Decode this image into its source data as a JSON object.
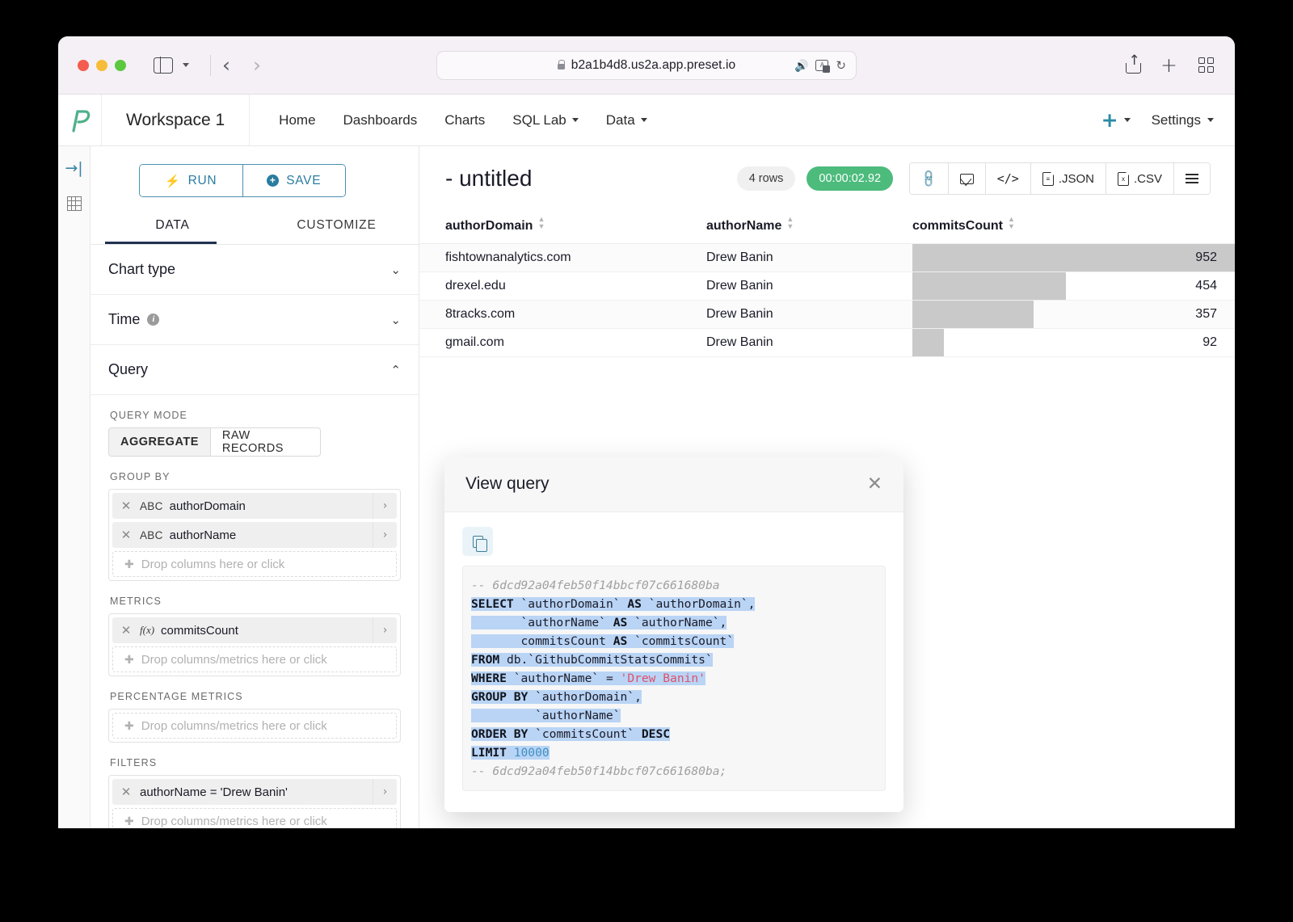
{
  "browser": {
    "url": "b2a1b4d8.us2a.app.preset.io",
    "lock_icon": "lock-icon",
    "back_glyph": "‹",
    "forward_glyph": "›",
    "speaker_glyph": "🔊",
    "reload_glyph": "↻",
    "translate_label": "A"
  },
  "appnav": {
    "logo": "preset-logo",
    "workspace": "Workspace 1",
    "links": [
      {
        "label": "Home",
        "caret": false
      },
      {
        "label": "Dashboards",
        "caret": false
      },
      {
        "label": "Charts",
        "caret": false
      },
      {
        "label": "SQL Lab",
        "caret": true
      },
      {
        "label": "Data",
        "caret": true
      }
    ],
    "plus_label": "+",
    "settings_label": "Settings"
  },
  "rail": {
    "expand_glyph": "→|",
    "table_icon": "table-icon"
  },
  "control_panel": {
    "run_label": "RUN",
    "run_icon": "⚡",
    "save_label": "SAVE",
    "tabs": [
      {
        "label": "DATA",
        "active": true
      },
      {
        "label": "CUSTOMIZE",
        "active": false
      }
    ],
    "sections": [
      {
        "label": "Chart type",
        "expanded": false,
        "chev": "⌄"
      },
      {
        "label": "Time",
        "expanded": false,
        "chev": "⌄",
        "info": true
      },
      {
        "label": "Query",
        "expanded": true,
        "chev": "⌃"
      }
    ],
    "query": {
      "query_mode_label": "QUERY MODE",
      "modes": [
        {
          "label": "AGGREGATE",
          "selected": true
        },
        {
          "label": "RAW RECORDS",
          "selected": false
        }
      ],
      "group_by_label": "GROUP BY",
      "group_by": [
        {
          "type": "ABC",
          "label": "authorDomain"
        },
        {
          "type": "ABC",
          "label": "authorName"
        }
      ],
      "group_by_placeholder": "Drop columns here or click",
      "metrics_label": "METRICS",
      "metrics": [
        {
          "type": "f(x)",
          "label": "commitsCount"
        }
      ],
      "metrics_placeholder": "Drop columns/metrics here or click",
      "percentage_metrics_label": "PERCENTAGE METRICS",
      "percentage_metrics_placeholder": "Drop columns/metrics here or click",
      "filters_label": "FILTERS",
      "filters": [
        {
          "label": "authorName = 'Drew Banin'"
        }
      ],
      "filters_placeholder": "Drop columns/metrics here or click"
    }
  },
  "results": {
    "title": "- untitled",
    "rows_badge": "4 rows",
    "time_badge": "00:00:02.92",
    "time_badge_color": "#4cbb7c",
    "toolbar": [
      {
        "name": "share-link-button",
        "label": ""
      },
      {
        "name": "email-button",
        "label": ""
      },
      {
        "name": "embed-code-button",
        "label": ""
      },
      {
        "name": "download-json-button",
        "label": ".JSON"
      },
      {
        "name": "download-csv-button",
        "label": ".CSV"
      },
      {
        "name": "more-menu-button",
        "label": ""
      }
    ],
    "columns": [
      "authorDomain",
      "authorName",
      "commitsCount"
    ],
    "rows": [
      {
        "authorDomain": "fishtownanalytics.com",
        "authorName": "Drew Banin",
        "commitsCount": "952",
        "bar_pct": 100
      },
      {
        "authorDomain": "drexel.edu",
        "authorName": "Drew Banin",
        "commitsCount": "454",
        "bar_pct": 47.7
      },
      {
        "authorDomain": "8tracks.com",
        "authorName": "Drew Banin",
        "commitsCount": "357",
        "bar_pct": 37.5
      },
      {
        "authorDomain": "gmail.com",
        "authorName": "Drew Banin",
        "commitsCount": "92",
        "bar_pct": 9.7
      }
    ]
  },
  "modal": {
    "title": "View query",
    "close_glyph": "✕",
    "copy_icon": "copy-icon",
    "sql_hash_top": "-- 6dcd92a04feb50f14bbcf07c661680ba",
    "sql_hash_bottom": "-- 6dcd92a04feb50f14bbcf07c661680ba;",
    "sql_lines": [
      "SELECT `authorDomain` AS `authorDomain`,",
      "       `authorName` AS `authorName`,",
      "       commitsCount AS `commitsCount`",
      "FROM db.`GithubCommitStatsCommits`",
      "WHERE `authorName` = 'Drew Banin'",
      "GROUP BY `authorDomain`,",
      "         `authorName`",
      "ORDER BY `commitsCount` DESC",
      "LIMIT 10000"
    ]
  },
  "chart_data": {
    "type": "table",
    "title": "- untitled",
    "columns": [
      "authorDomain",
      "authorName",
      "commitsCount"
    ],
    "categories": [
      "fishtownanalytics.com",
      "drexel.edu",
      "8tracks.com",
      "gmail.com"
    ],
    "values": [
      952,
      454,
      357,
      92
    ],
    "series": [
      {
        "name": "commitsCount",
        "values": [
          952,
          454,
          357,
          92
        ]
      }
    ],
    "xlabel": "authorDomain",
    "ylabel": "commitsCount",
    "ylim": [
      0,
      952
    ],
    "grid": false,
    "legend": "none",
    "annotations": [
      "4 rows",
      "00:00:02.92"
    ]
  }
}
